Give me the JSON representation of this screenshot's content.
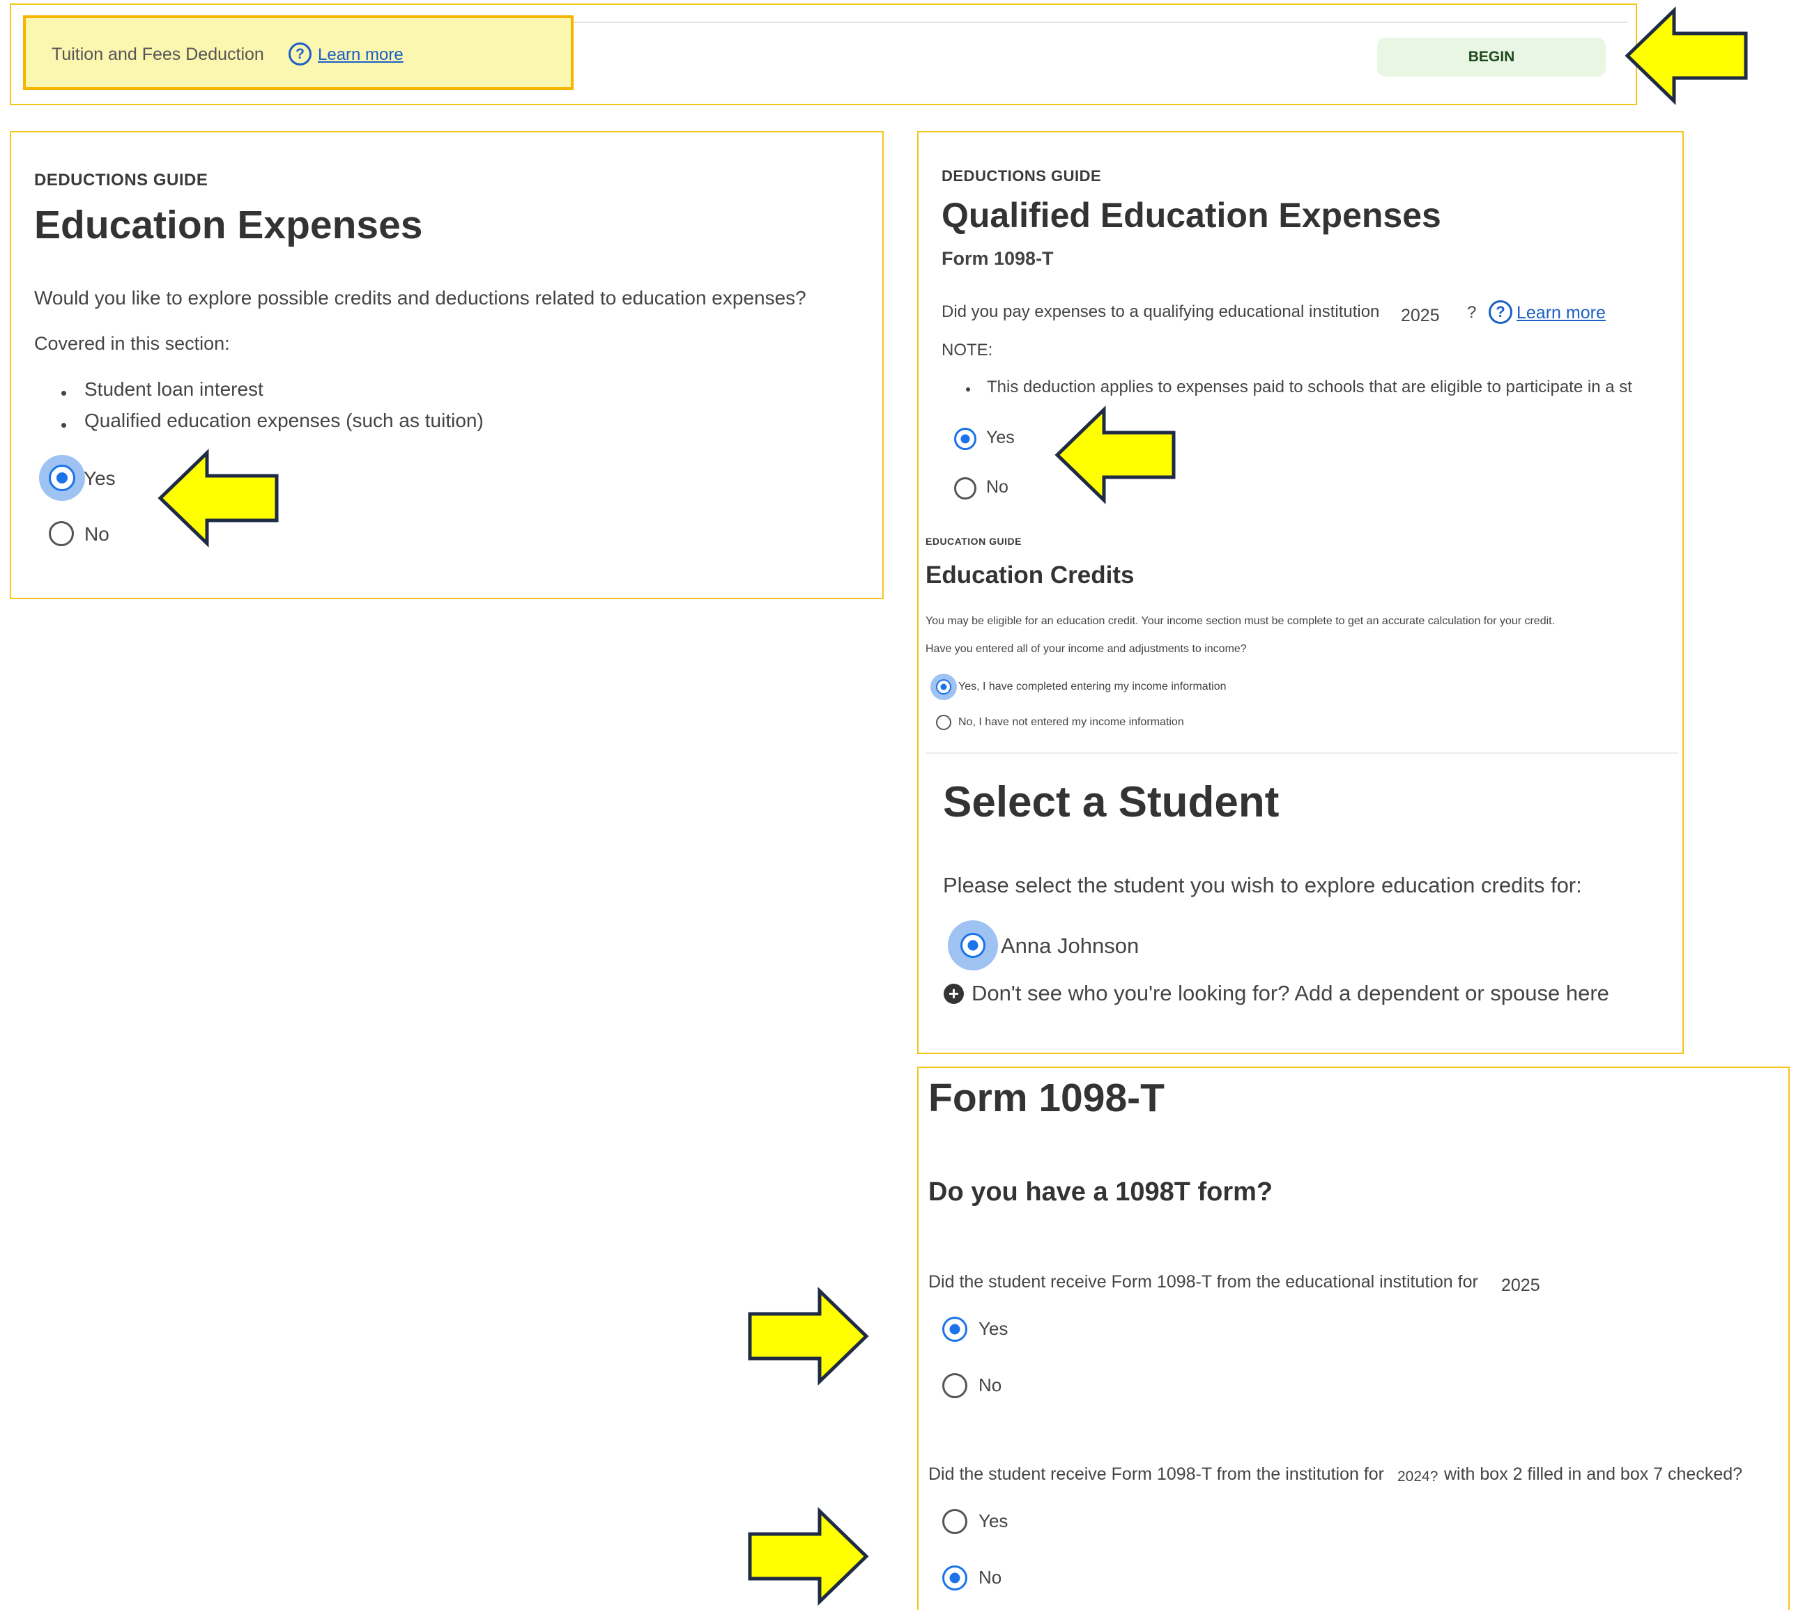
{
  "tuition_bar": {
    "label": "Tuition and Fees Deduction",
    "help_icon": "question-circle-icon",
    "learn_more": "Learn more",
    "begin_button": "BEGIN"
  },
  "education_expenses": {
    "eyebrow": "DEDUCTIONS GUIDE",
    "title": "Education Expenses",
    "question": "Would you like to explore possible credits and deductions related to education expenses?",
    "covered_label": "Covered in this section:",
    "items": [
      "Student loan interest",
      "Qualified education expenses (such as tuition)"
    ],
    "options": [
      {
        "label": "Yes",
        "selected": true
      },
      {
        "label": "No",
        "selected": false
      }
    ]
  },
  "qualified_expenses": {
    "eyebrow": "DEDUCTIONS GUIDE",
    "title": "Qualified Education Expenses",
    "subtitle": "Form 1098-T",
    "question": "Did you pay expenses to a qualifying educational institution",
    "year": "2025",
    "question_mark": "?",
    "help_icon": "question-circle-icon",
    "learn_more": "Learn more",
    "note_label": "NOTE:",
    "note_item": "This deduction applies to expenses paid to schools that are eligible to participate in a st",
    "options": [
      {
        "label": "Yes",
        "selected": true
      },
      {
        "label": "No",
        "selected": false
      }
    ]
  },
  "education_credits": {
    "eyebrow": "EDUCATION GUIDE",
    "title": "Education Credits",
    "info": "You may be eligible for an education credit. Your income section must be complete to get an accurate calculation for your credit.",
    "question": "Have you entered all of your income and adjustments to income?",
    "options": [
      {
        "label": "Yes, I have completed entering my income information",
        "selected": true
      },
      {
        "label": "No, I have not entered my income information",
        "selected": false
      }
    ]
  },
  "select_student": {
    "title": "Select a Student",
    "prompt": "Please select the student you wish to explore education credits for:",
    "student": "Anna Johnson",
    "add_link": "Don't see who you're looking for? Add a dependent or spouse here",
    "add_icon": "plus-circle-icon"
  },
  "form_1098t": {
    "title": "Form 1098-T",
    "subtitle": "Do you have a 1098T form?",
    "q1": "Did the student receive Form 1098-T from the educational institution for",
    "q1_year": "2025",
    "q1_options": [
      {
        "label": "Yes",
        "selected": true
      },
      {
        "label": "No",
        "selected": false
      }
    ],
    "q2_start": "Did the student receive Form 1098-T from the institution for",
    "q2_year": "2024?",
    "q2_end": "with box 2 filled in and box 7 checked?",
    "q2_options": [
      {
        "label": "Yes",
        "selected": false
      },
      {
        "label": "No",
        "selected": true
      }
    ]
  },
  "annotations": {
    "arrow_icon": "yellow-arrow-icon",
    "arrow_fill": "#ffff00",
    "arrow_stroke": "#1f2a44",
    "panel_border": "#f5c518"
  }
}
